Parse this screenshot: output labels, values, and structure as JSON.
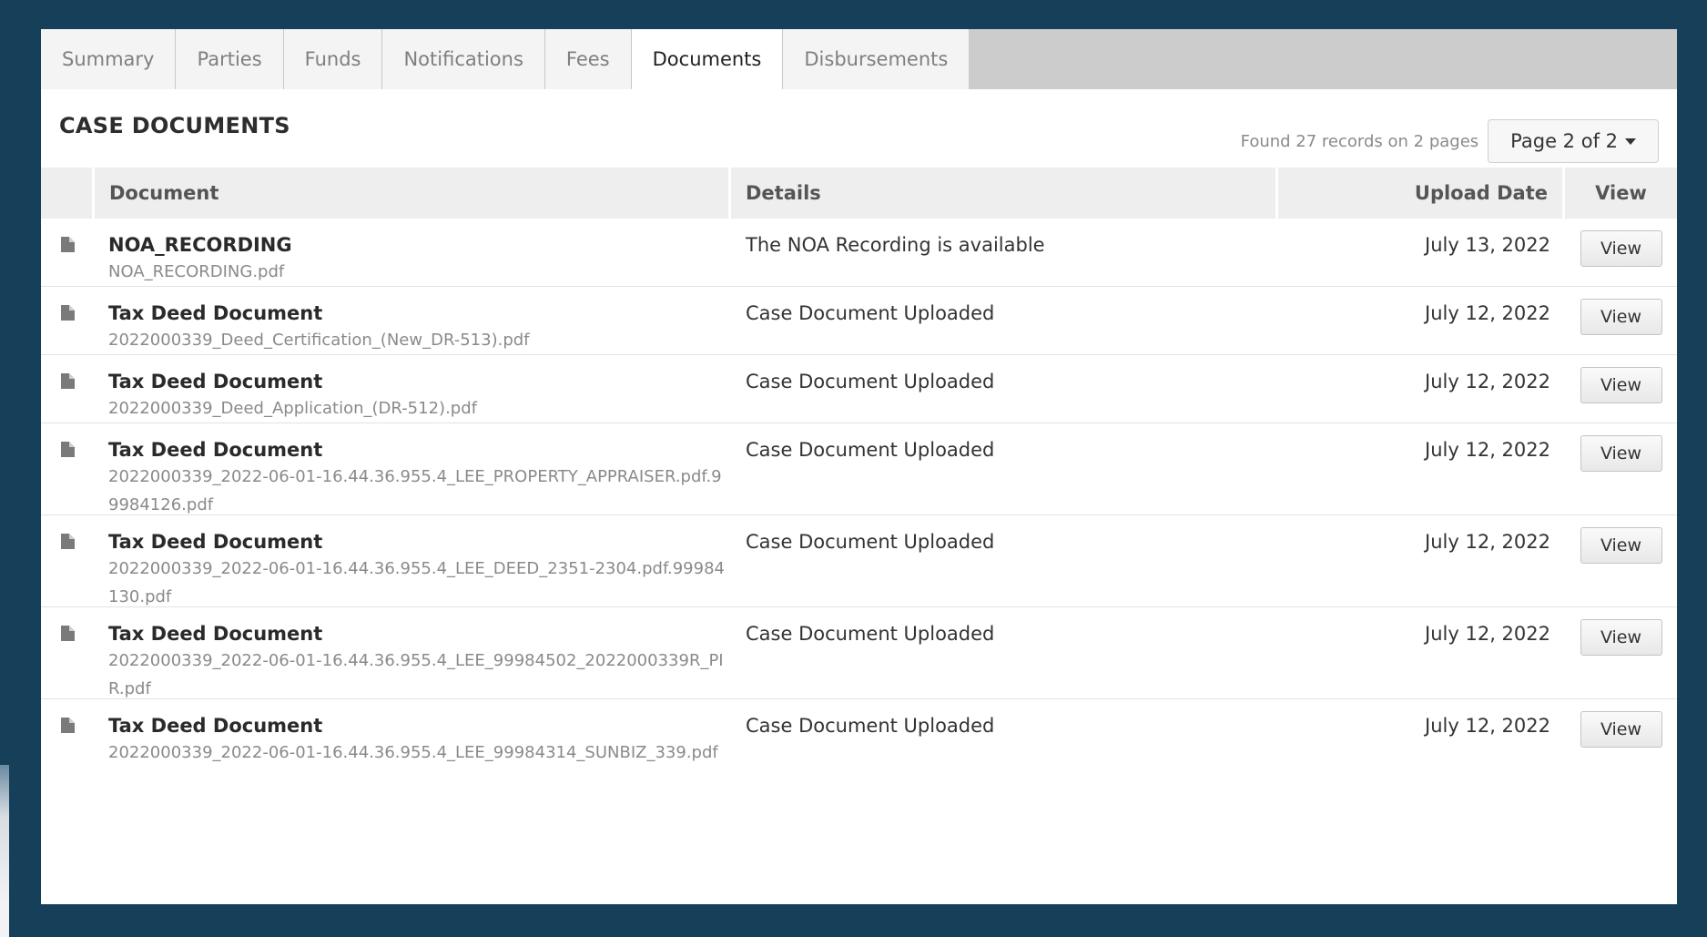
{
  "tabs": [
    {
      "label": "Summary",
      "active": false
    },
    {
      "label": "Parties",
      "active": false
    },
    {
      "label": "Funds",
      "active": false
    },
    {
      "label": "Notifications",
      "active": false
    },
    {
      "label": "Fees",
      "active": false
    },
    {
      "label": "Documents",
      "active": true
    },
    {
      "label": "Disbursements",
      "active": false
    }
  ],
  "section": {
    "title": "CASE DOCUMENTS",
    "record_count": "Found 27 records on 2 pages",
    "page_label": "Page 2 of 2"
  },
  "table": {
    "headers": {
      "document": "Document",
      "details": "Details",
      "upload_date": "Upload Date",
      "view": "View"
    },
    "rows": [
      {
        "name": "NOA_RECORDING",
        "file": "NOA_RECORDING.pdf",
        "details": "The NOA Recording is available",
        "date": "July 13, 2022",
        "view_label": "View"
      },
      {
        "name": "Tax Deed Document",
        "file": "2022000339_Deed_Certification_(New_DR-513).pdf",
        "details": "Case Document Uploaded",
        "date": "July 12, 2022",
        "view_label": "View"
      },
      {
        "name": "Tax Deed Document",
        "file": "2022000339_Deed_Application_(DR-512).pdf",
        "details": "Case Document Uploaded",
        "date": "July 12, 2022",
        "view_label": "View"
      },
      {
        "name": "Tax Deed Document",
        "file": "2022000339_2022-06-01-16.44.36.955.4_LEE_PROPERTY_APPRAISER.pdf.99984126.pdf",
        "details": "Case Document Uploaded",
        "date": "July 12, 2022",
        "view_label": "View"
      },
      {
        "name": "Tax Deed Document",
        "file": "2022000339_2022-06-01-16.44.36.955.4_LEE_DEED_2351-2304.pdf.99984130.pdf",
        "details": "Case Document Uploaded",
        "date": "July 12, 2022",
        "view_label": "View"
      },
      {
        "name": "Tax Deed Document",
        "file": "2022000339_2022-06-01-16.44.36.955.4_LEE_99984502_2022000339R_PIR.pdf",
        "details": "Case Document Uploaded",
        "date": "July 12, 2022",
        "view_label": "View"
      },
      {
        "name": "Tax Deed Document",
        "file": "2022000339_2022-06-01-16.44.36.955.4_LEE_99984314_SUNBIZ_339.pdf",
        "details": "Case Document Uploaded",
        "date": "July 12, 2022",
        "view_label": "View"
      }
    ]
  },
  "colors": {
    "background": "#163f5a",
    "tab_bar": "#cccccc",
    "header_row": "#eeeeee"
  },
  "icons": {
    "row_icon": "file-icon",
    "page_select_icon": "caret-down-icon"
  }
}
